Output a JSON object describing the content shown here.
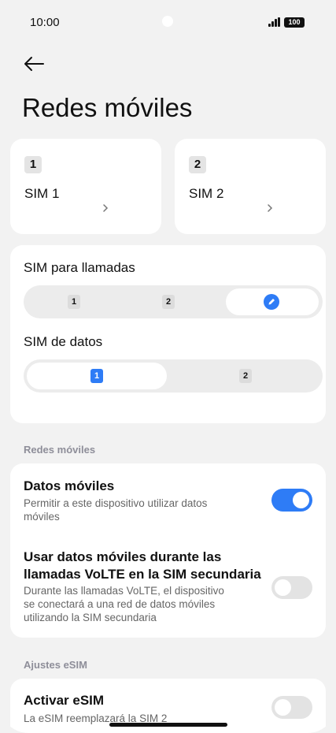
{
  "status_bar": {
    "time": "10:00",
    "battery": "100"
  },
  "page": {
    "title": "Redes móviles"
  },
  "sim_cards": [
    {
      "badge": "1",
      "name": "SIM 1"
    },
    {
      "badge": "2",
      "name": "SIM 2"
    }
  ],
  "sim_calls": {
    "label": "SIM para llamadas",
    "options": [
      "1",
      "2"
    ],
    "selected": "ask-every-time"
  },
  "sim_data": {
    "label": "SIM de datos",
    "options": [
      "1",
      "2"
    ],
    "selected": "1"
  },
  "mobile_networks_section": {
    "label": "Redes móviles",
    "mobile_data": {
      "title": "Datos móviles",
      "desc_line1": "Permitir a este dispositivo utilizar datos",
      "desc_line2": "móviles",
      "enabled": true
    },
    "volte_data": {
      "title_line1": "Usar datos móviles durante las",
      "title_line2": "llamadas VoLTE en la SIM secundaria",
      "desc_line1": "Durante las llamadas VoLTE, el dispositivo",
      "desc_line2": "se conectará a una red de datos móviles",
      "desc_line3": "utilizando la SIM secundaria",
      "enabled": false
    }
  },
  "esim_section": {
    "label": "Ajustes eSIM",
    "activate": {
      "title": "Activar eSIM",
      "desc": "La eSIM reemplazará la SIM 2",
      "enabled": false
    }
  },
  "colors": {
    "accent": "#2e7cf6",
    "background": "#f2f2f2",
    "card": "#ffffff"
  }
}
